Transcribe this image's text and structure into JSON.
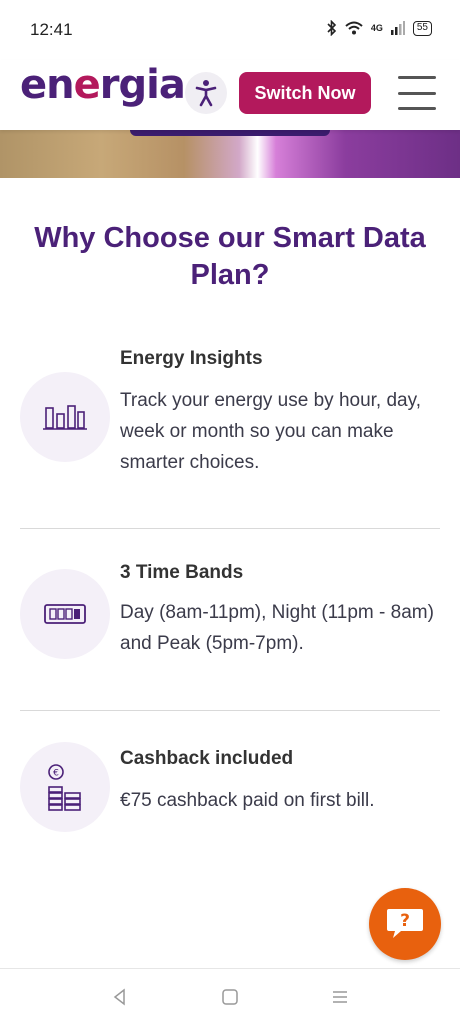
{
  "status_bar": {
    "time": "12:41",
    "network": "4G",
    "battery": "55"
  },
  "header": {
    "logo_prefix": "en",
    "logo_accent": "e",
    "logo_suffix": "rgia",
    "switch_label": "Switch Now"
  },
  "section": {
    "title": "Why Choose our Smart Data Plan?"
  },
  "features": [
    {
      "title": "Energy Insights",
      "description": "Track your energy use by hour, day, week or month so you can make smarter choices.",
      "icon": "bar-chart-icon"
    },
    {
      "title": "3 Time Bands",
      "description": "Day (8am-11pm), Night (11pm - 8am) and Peak (5pm-7pm).",
      "icon": "meter-icon"
    },
    {
      "title": "Cashback included",
      "description": "€75 cashback paid on first bill.",
      "icon": "euro-coins-icon"
    }
  ],
  "colors": {
    "brand_purple": "#4b2178",
    "brand_magenta": "#b3195c",
    "chat_orange": "#e8610e",
    "icon_bg": "#f4f0f8"
  }
}
